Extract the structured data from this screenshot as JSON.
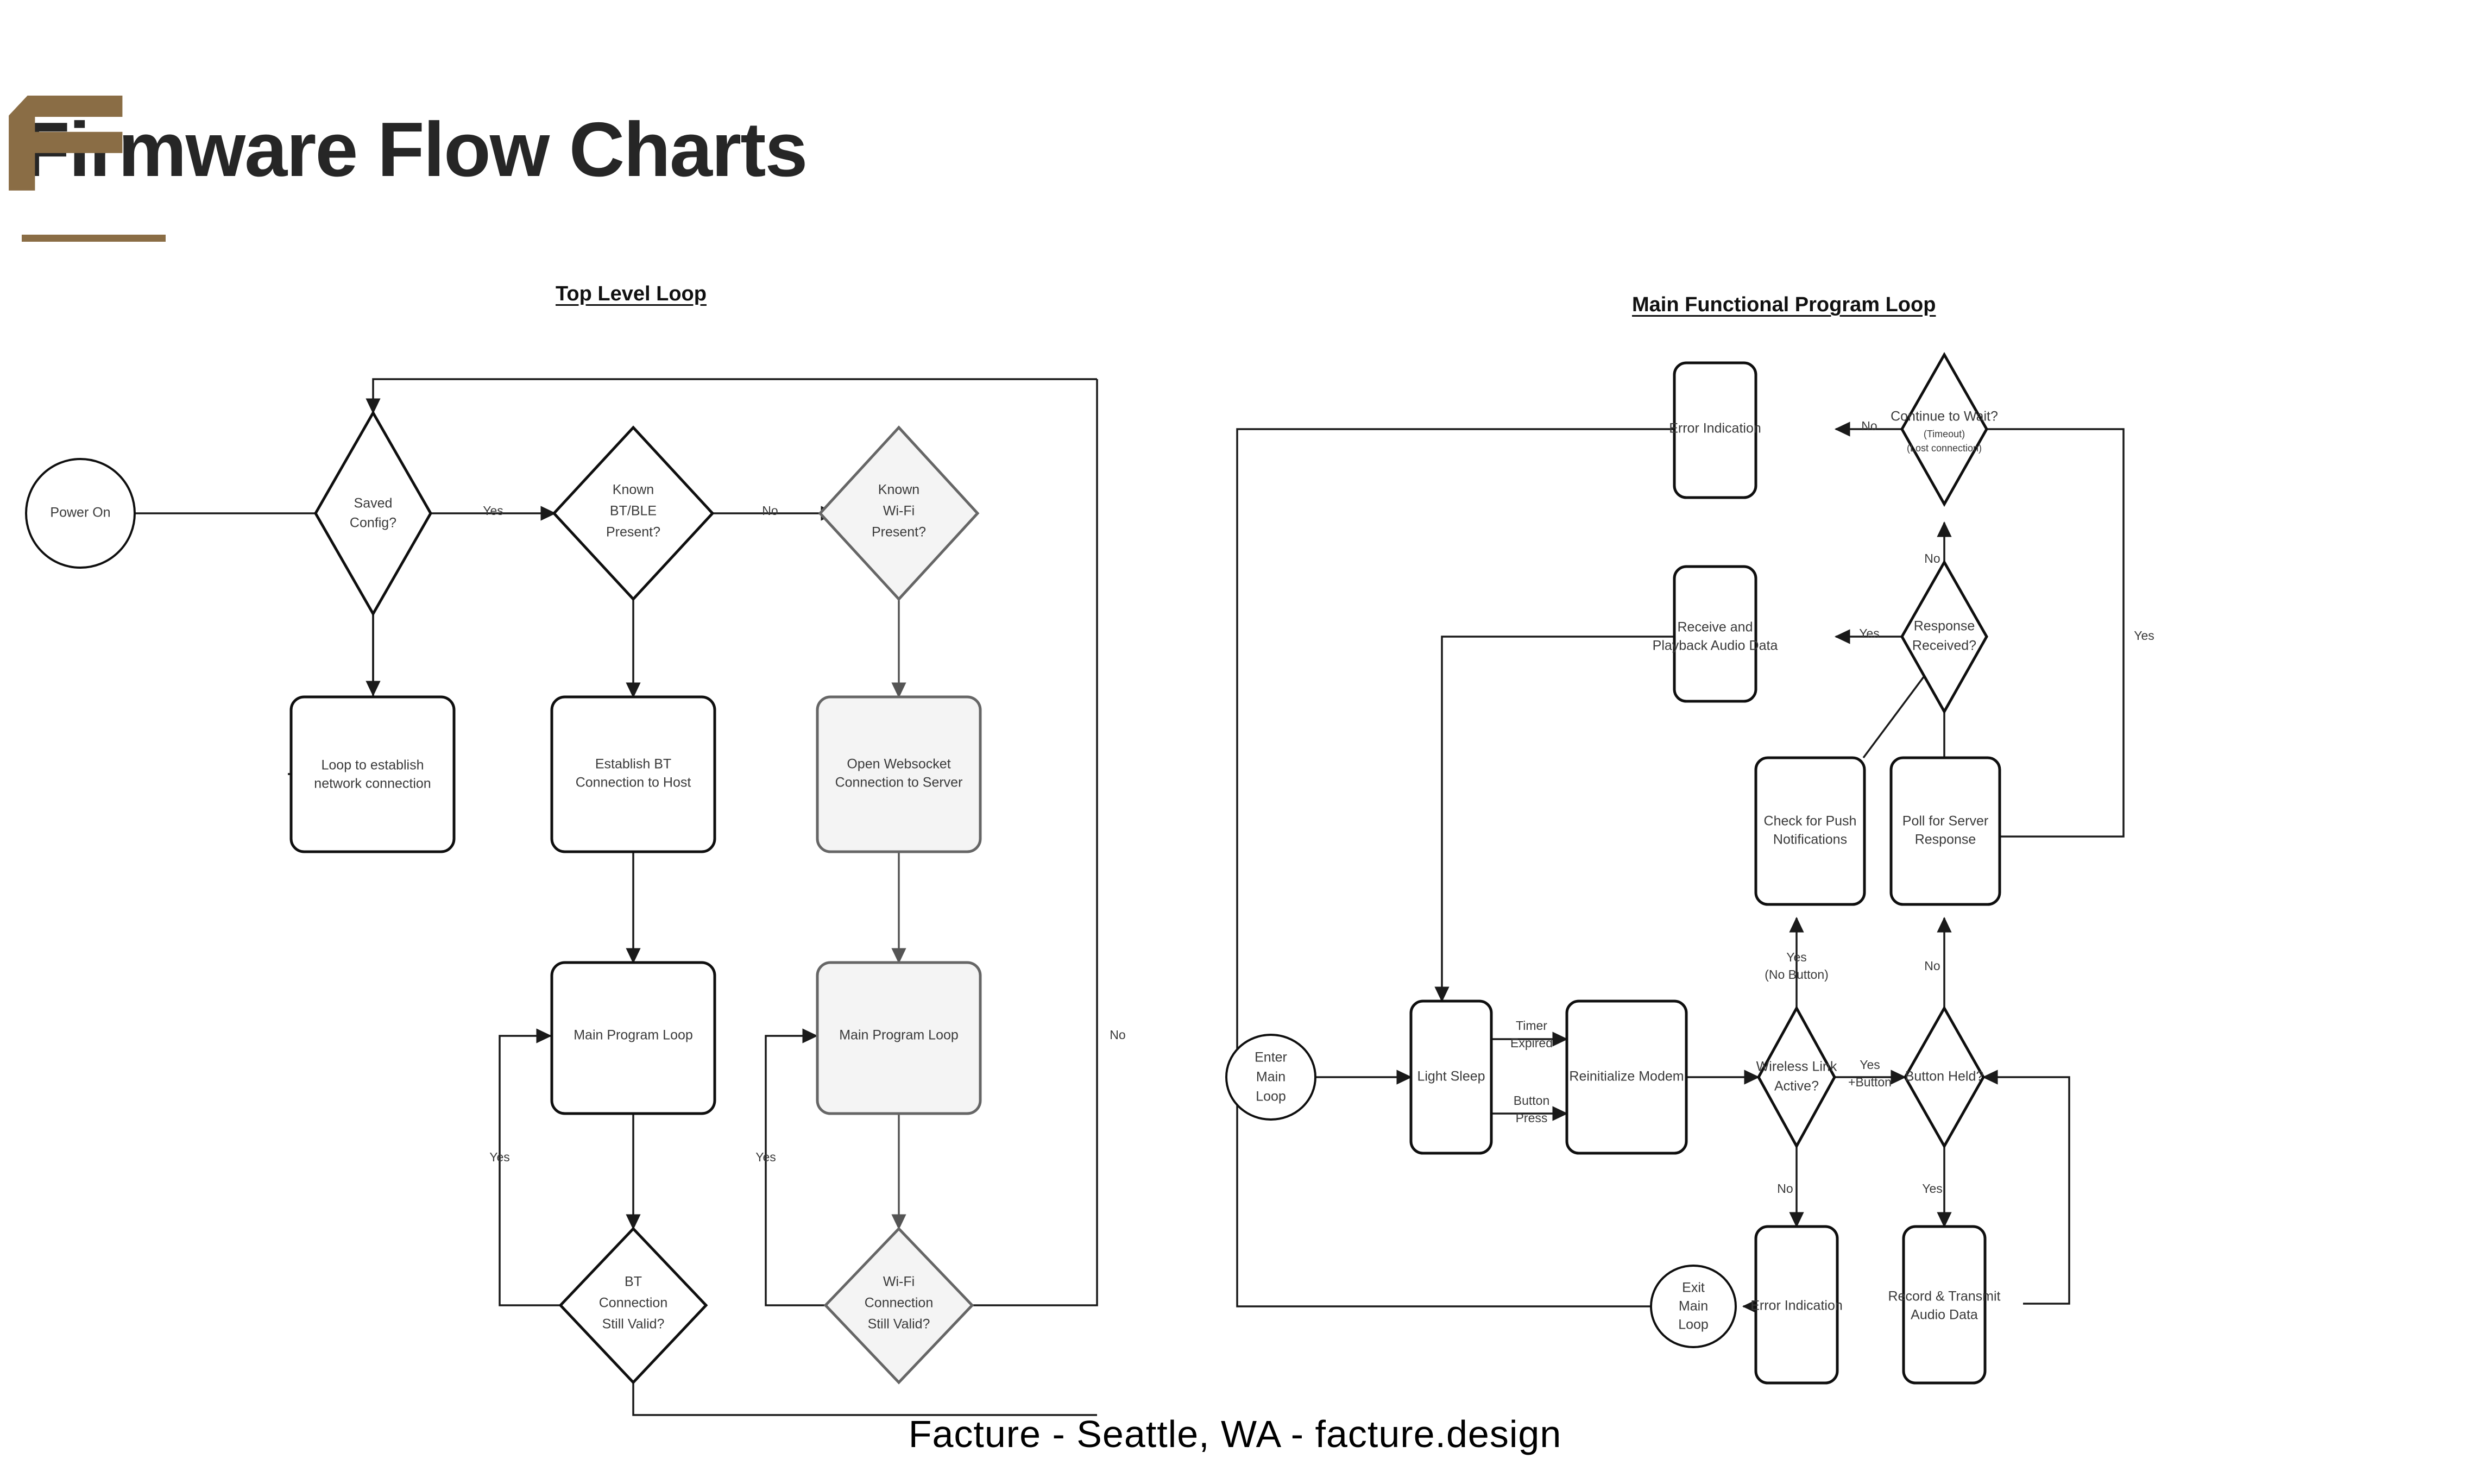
{
  "page": {
    "title": "Firmware Flow Charts",
    "accent_color": "#8a6d45",
    "footer": "Facture   -   Seattle, WA    -   facture.design"
  },
  "logo": {
    "name": "facture-f-logo",
    "color": "#8a6d45"
  },
  "charts": [
    {
      "id": "top_level_loop",
      "title": "Top Level Loop",
      "nodes": {
        "power_on": "Power On",
        "saved_config": "Saved Config?",
        "loop_network": "Loop to establish network connection",
        "known_btble": "Known BT/BLE Present?",
        "establish_bt": "Establish BT Connection to Host",
        "main_loop_bt": "Main Program Loop",
        "bt_valid": "BT Connection Still Valid?",
        "known_wifi": "Known Wi-Fi Present?",
        "open_ws": "Open Websocket Connection to Server",
        "main_loop_wifi": "Main Program Loop",
        "wifi_valid": "Wi-Fi Connection Still Valid?"
      },
      "edge_labels": {
        "saved_to_btble": "Yes",
        "btble_to_wifi": "No",
        "bt_valid_yes": "Yes",
        "wifi_valid_yes": "Yes",
        "wifi_valid_no": "No"
      }
    },
    {
      "id": "main_functional_program_loop",
      "title": "Main Functional Program Loop",
      "nodes": {
        "enter_main_loop": "Enter Main Loop",
        "light_sleep": "Light Sleep",
        "reinit_modem": "Reinitialize Modem",
        "wireless_link_active": "Wireless Link Active?",
        "button_held": "Button Held?",
        "check_push": "Check for Push Notifications",
        "poll_server": "Poll for Server Response",
        "response_received": "Response Received?",
        "continue_to_wait": "Continue to Wait?",
        "continue_to_wait_sub1": "(Timeout)",
        "continue_to_wait_sub2": "(Lost connection)",
        "error_indication_top": "Error Indication",
        "receive_playback": "Receive and Playback Audio Data",
        "error_indication_bottom": "Error Indication",
        "record_transmit": "Record & Transmit Audio Data",
        "exit_main_loop": "Exit Main Loop"
      },
      "edge_labels": {
        "timer_expired": "Timer Expired",
        "button_press": "Button Press",
        "wireless_yes_button": "Yes +Button",
        "wireless_no": "No",
        "button_held_no": "No",
        "button_held_yes": "Yes",
        "push_yes_nobutton": "Yes (No Button)",
        "response_no": "No",
        "response_yes": "Yes",
        "wait_no": "No",
        "wait_yes": "Yes"
      }
    }
  ]
}
